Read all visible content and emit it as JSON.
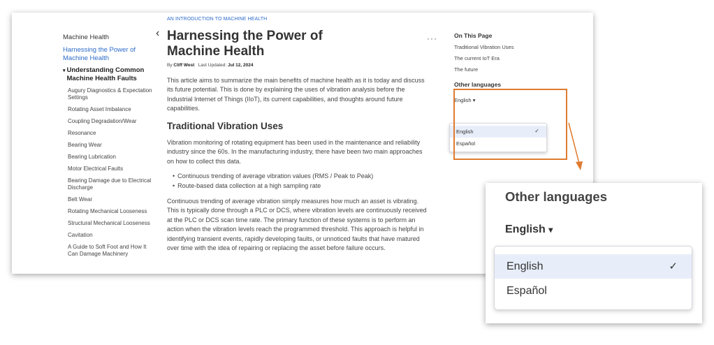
{
  "sidebar": {
    "top": "Machine Health",
    "active": "Harnessing the Power of Machine Health",
    "group": "Understanding Common Machine Health Faults",
    "items": [
      "Augury Diagnostics & Expectation Settings",
      "Rotating Asset Imbalance",
      "Coupling Degradation/Wear",
      "Resonance",
      "Bearing Wear",
      "Bearing Lubrication",
      "Motor Electrical Faults",
      "Bearing Damage due to Electrical Discharge",
      "Belt Wear",
      "Rotating Mechanical Looseness",
      "Structural Mechanical Looseness",
      "Cavitation",
      "A Guide to Soft Foot and How It Can Damage Machinery"
    ]
  },
  "article": {
    "eyebrow": "AN INTRODUCTION TO MACHINE HEALTH",
    "title": "Harnessing the Power of Machine Health",
    "by_label": "By",
    "author": "Cliff West",
    "updated_label": "Last Updated:",
    "updated": "Jul 12, 2024",
    "intro": "This article aims to summarize the main benefits of machine health as it is today and discuss its future potential. This is done by explaining the uses of vibration analysis before the Industrial Internet of Things (IIoT), its current capabilities, and thoughts around future capabilities.",
    "section_title": "Traditional Vibration Uses",
    "para1": "Vibration monitoring of rotating equipment has been used in the maintenance and reliability industry since the 60s. In the manufacturing industry, there have been two main approaches on how to collect this data.",
    "bullets": [
      "Continuous trending of average vibration values (RMS / Peak to Peak)",
      "Route-based data collection at a high sampling rate"
    ],
    "para2": "Continuous trending of average vibration simply measures how much an asset is vibrating. This is typically done through a PLC or DCS, where vibration levels are continuously received at the PLC or DCS scan time rate. The primary function of these systems is to perform an action when the vibration levels reach the programmed threshold. This approach is helpful in identifying transient events, rapidly developing faults, or unnoticed faults that have matured over time with the idea of repairing or replacing the asset before failure occurs."
  },
  "more_label": "···",
  "back_label": "‹",
  "toc": {
    "title": "On This Page",
    "links": [
      "Traditional Vibration Uses",
      "The current IoT Era",
      "The future"
    ]
  },
  "languages": {
    "title": "Other languages",
    "selected": "English",
    "options": [
      "English",
      "Español"
    ],
    "check": "✓",
    "caret": "▾"
  },
  "colors": {
    "accent": "#2d6bc9",
    "highlight": "#e07b30"
  }
}
